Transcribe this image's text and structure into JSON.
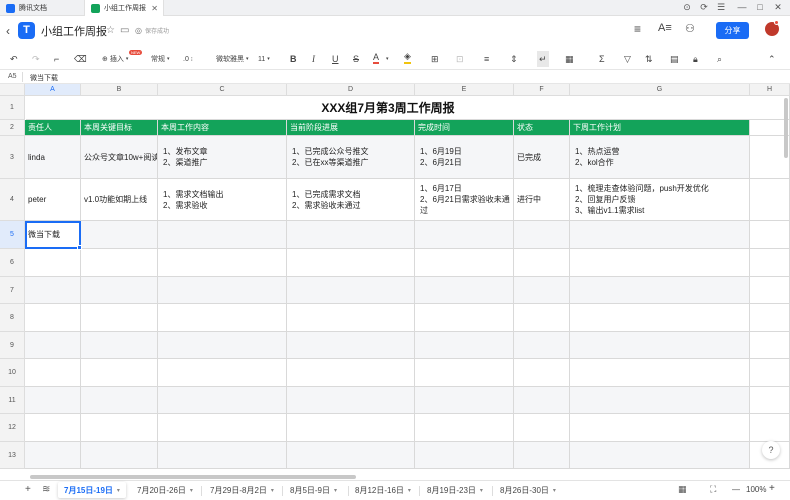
{
  "app_tabs": [
    {
      "label": "腾讯文档",
      "logo_color": "#1a6cf5"
    },
    {
      "label": "小组工作周报",
      "logo_color": "#13a35a"
    }
  ],
  "window_controls": [
    "⊙",
    "⟳",
    "☰",
    "—",
    "□",
    "✕"
  ],
  "doc": {
    "title": "小组工作周报",
    "saved_status": "保存成功",
    "share_label": "分享"
  },
  "toolbar": {
    "insert_label": "插入",
    "insert_badge": "NEW",
    "format_label": "常规",
    "decimal_label": ".0",
    "font_family": "微软雅黑",
    "font_size": "11",
    "bold": "B",
    "italic": "I",
    "underline": "U",
    "strike": "S",
    "font_color": "A"
  },
  "formula_bar": {
    "cell_ref": "A5",
    "value": "微当下载"
  },
  "columns": [
    "A",
    "B",
    "C",
    "D",
    "E",
    "F",
    "G",
    "H"
  ],
  "rows": [
    "1",
    "2",
    "3",
    "4",
    "5",
    "6",
    "7",
    "8",
    "9",
    "10",
    "11",
    "12",
    "13"
  ],
  "sheet": {
    "title": "XXX组7月第3周工作周报",
    "headers": [
      "责任人",
      "本周关键目标",
      "本周工作内容",
      "当前阶段进展",
      "完成时间",
      "状态",
      "下周工作计划"
    ],
    "data": [
      {
        "owner": "linda",
        "goal": "公众号文章10w+阅读",
        "work": [
          "1、发布文章",
          "2、渠道推广"
        ],
        "progress": [
          "1、已完成公众号推文",
          "2、已在xx等渠道推广"
        ],
        "done": [
          "1、6月19日",
          "2、6月21日"
        ],
        "status": "已完成",
        "next": [
          "1、热点运营",
          "2、kol合作"
        ]
      },
      {
        "owner": "peter",
        "goal": "v1.0功能如期上线",
        "work": [
          "1、需求文档输出",
          "2、需求验收"
        ],
        "progress": [
          "1、已完成需求文档",
          "2、需求验收未通过"
        ],
        "done": [
          "1、6月17日",
          "2、6月21日需求验收未通过"
        ],
        "status": "进行中",
        "next": [
          "1、梳理走查体验问题，push开发优化",
          "2、回复用户反馈",
          "3、输出v1.1需求list"
        ]
      }
    ],
    "a5_value": "微当下载"
  },
  "sheet_tabs": [
    "7月15日-19日",
    "7月20日-26日",
    "7月29日-8月2日",
    "8月5日-9日",
    "8月12日-16日",
    "8月19日-23日",
    "8月26日-30日"
  ],
  "zoom": "100%",
  "help_label": "?",
  "colors": {
    "accent": "#1a6cf5",
    "header_green": "#13a35a",
    "alert_red": "#e74c3c"
  }
}
